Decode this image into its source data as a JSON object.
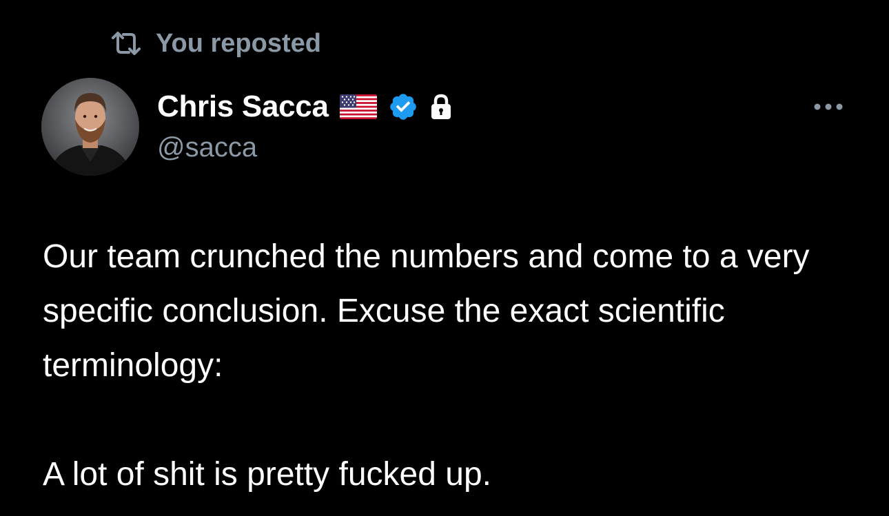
{
  "repost": {
    "icon": "repost-icon",
    "label": "You reposted"
  },
  "author": {
    "avatar_icon": "avatar",
    "display_name": "Chris Sacca",
    "handle": "@sacca",
    "badges": [
      "us-flag-icon",
      "verified-badge-icon",
      "lock-icon"
    ],
    "verified_color": "#1d9bf0"
  },
  "menu": {
    "icon": "more-options-icon"
  },
  "tweet": {
    "paragraphs": [
      "Our team crunched the numbers and come to a very specific conclusion. Excuse the exact scientific terminology:",
      "A lot of shit is pretty fucked up."
    ]
  },
  "colors": {
    "background": "#000000",
    "text_primary": "#ffffff",
    "text_secondary": "#8b98a5",
    "accent": "#1d9bf0"
  }
}
